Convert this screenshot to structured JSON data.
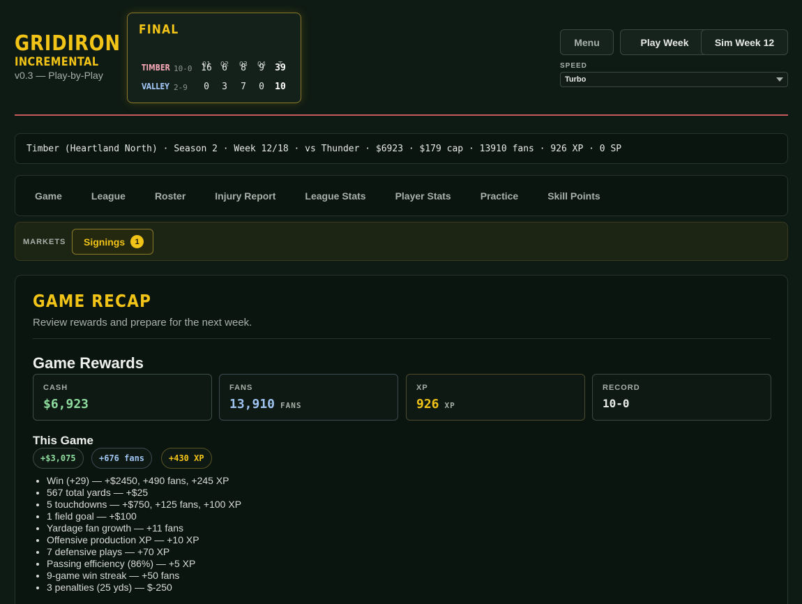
{
  "logo": {
    "title": "GRIDIRON",
    "subtitle": "INCREMENTAL",
    "version": "v0.3 — Play-by-Play"
  },
  "scoreboard": {
    "status": "FINAL",
    "quarters": [
      "Q1",
      "Q2",
      "Q3",
      "Q4",
      "T"
    ],
    "teams": [
      {
        "name": "TIMBER",
        "record": "10-0",
        "scores": [
          "16",
          "6",
          "8",
          "9",
          "39"
        ],
        "color": "#f4a6b4"
      },
      {
        "name": "VALLEY",
        "record": "2-9",
        "scores": [
          "0",
          "3",
          "7",
          "0",
          "10"
        ],
        "color": "#9fc4f2"
      }
    ]
  },
  "header_buttons": {
    "menu": "Menu",
    "play_week": "Play Week",
    "sim_week": "Sim Week 12"
  },
  "speed": {
    "label": "SPEED",
    "selected": "Turbo"
  },
  "status_line": "Timber (Heartland North) · Season 2 · Week 12/18 · vs Thunder · $6923 · $179 cap · 13910 fans · 926 XP · 0 SP",
  "tabs": [
    "Game",
    "League",
    "Roster",
    "Injury Report",
    "League Stats",
    "Player Stats",
    "Practice",
    "Skill Points"
  ],
  "markets": {
    "label": "MARKETS",
    "signings_label": "Signings",
    "signings_count": "1"
  },
  "recap": {
    "title": "GAME RECAP",
    "subtitle": "Review rewards and prepare for the next week.",
    "rewards_heading": "Game Rewards",
    "cards": [
      {
        "label": "CASH",
        "value": "$6,923",
        "unit": "",
        "color": "#8fdc9f"
      },
      {
        "label": "FANS",
        "value": "13,910",
        "unit": "FANS",
        "color": "#9fc4f2"
      },
      {
        "label": "XP",
        "value": "926",
        "unit": "XP",
        "color": "#f2c418"
      },
      {
        "label": "RECORD",
        "value": "10-0",
        "unit": "",
        "color": "#e8ebe8"
      }
    ],
    "this_game_heading": "This Game",
    "chips": [
      {
        "text": "+$3,075",
        "color": "#8fdc9f",
        "border": "#3d4e43"
      },
      {
        "text": "+676 fans",
        "color": "#9fc4f2",
        "border": "#3c4a52"
      },
      {
        "text": "+430 XP",
        "color": "#f2c418",
        "border": "#5a5424"
      }
    ],
    "events": [
      "Win (+29) — +$2450, +490 fans, +245 XP",
      "567 total yards — +$25",
      "5 touchdowns — +$750, +125 fans, +100 XP",
      "1 field goal — +$100",
      "Yardage fan growth — +11 fans",
      "Offensive production XP — +10 XP",
      "7 defensive plays — +70 XP",
      "Passing efficiency (86%) — +5 XP",
      "9-game win streak — +50 fans",
      "3 penalties (25 yds) — $-250"
    ]
  }
}
